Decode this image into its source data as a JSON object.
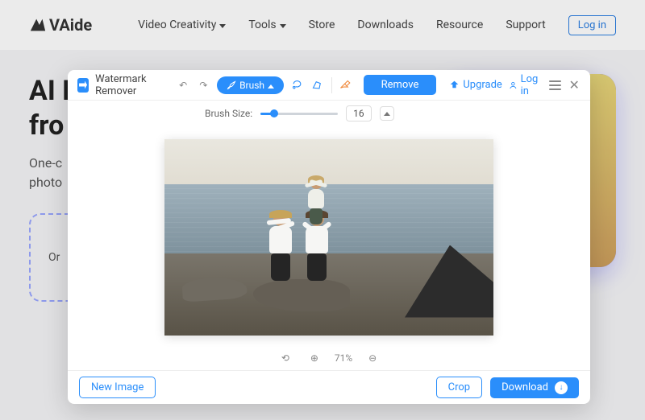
{
  "site": {
    "logo_text": "VAide",
    "nav": [
      "Video Creativity",
      "Tools",
      "Store",
      "Downloads",
      "Resource",
      "Support"
    ],
    "login_label": "Log in",
    "hero_title_line1": "AI P",
    "hero_title_line2": "fro",
    "hero_sub_line1": "One-c",
    "hero_sub_line2": "photo",
    "dropzone_prefix": "Or"
  },
  "app": {
    "title": "Watermark Remover",
    "tools": {
      "brush_label": "Brush",
      "brush_size_label": "Brush Size:",
      "brush_size_value": "16"
    },
    "remove_label": "Remove",
    "upgrade_label": "Upgrade",
    "login_label": "Log in",
    "zoom_level": "71%",
    "bottom": {
      "new_image_label": "New Image",
      "crop_label": "Crop",
      "download_label": "Download"
    }
  }
}
